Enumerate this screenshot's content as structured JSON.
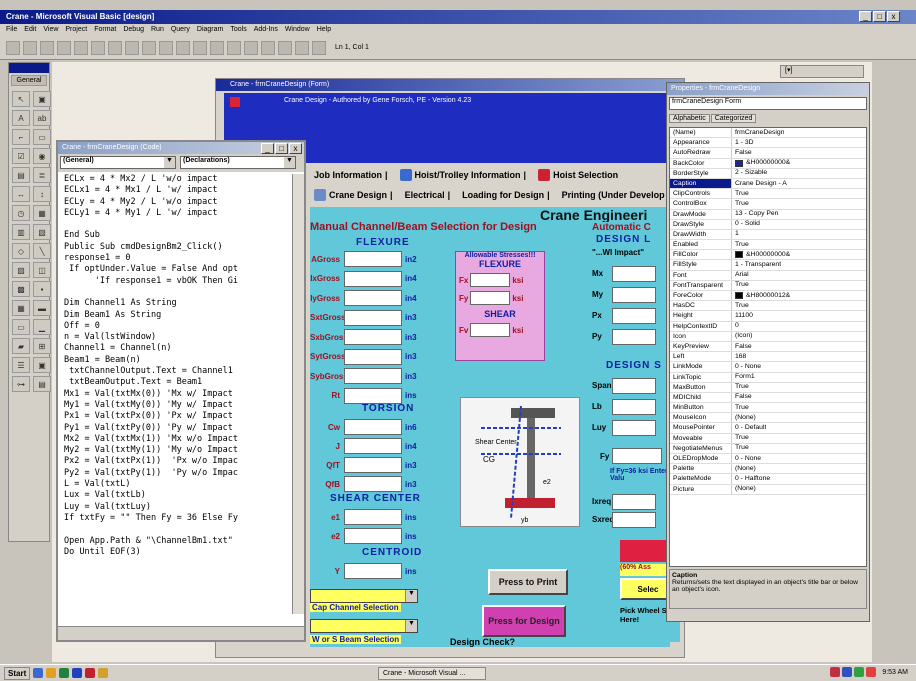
{
  "window": {
    "title": "Crane - Microsoft Visual Basic [design]"
  },
  "menu": [
    "File",
    "Edit",
    "View",
    "Project",
    "Format",
    "Debug",
    "Run",
    "Query",
    "Diagram",
    "Tools",
    "Add-Ins",
    "Window",
    "Help"
  ],
  "toolbar": {
    "position": "Ln 1, Col 1"
  },
  "toolbox": {
    "label": "General"
  },
  "form": {
    "title": "Crane - frmCraneDesign (Form)",
    "header": "Crane Design - Authored by Gene Forsch, PE - Version 4.23",
    "tabs_row1": [
      "Job Information",
      "Hoist/Trolley Information",
      "Hoist Selection"
    ],
    "tabs_row2": [
      "Crane Design",
      "Electrical",
      "Loading for Design",
      "Printing (Under Develop"
    ],
    "crane_engineering": "Crane Engineeri",
    "manual_title": "Manual Channel/Beam Selection for Design",
    "automatic_title": "Automatic C",
    "design_l": "DESIGN L",
    "flexure": {
      "heading": "FLEXURE",
      "fields": [
        {
          "label": "AGross",
          "unit": "in2"
        },
        {
          "label": "IxGross",
          "unit": "in4"
        },
        {
          "label": "IyGross",
          "unit": "in4"
        },
        {
          "label": "SxtGross",
          "unit": "in3"
        },
        {
          "label": "SxbGross",
          "unit": "in3"
        },
        {
          "label": "SytGross",
          "unit": "in3"
        },
        {
          "label": "SybGross",
          "unit": "in3"
        },
        {
          "label": "Rt",
          "unit": "ins"
        }
      ]
    },
    "torsion": {
      "heading": "TORSION",
      "fields": [
        {
          "label": "Cw",
          "unit": "in6"
        },
        {
          "label": "J",
          "unit": "in4"
        },
        {
          "label": "QfT",
          "unit": "in3"
        },
        {
          "label": "QfB",
          "unit": "in3"
        }
      ]
    },
    "shear_center": {
      "heading": "SHEAR CENTER",
      "fields": [
        {
          "label": "e1",
          "unit": "ins"
        },
        {
          "label": "e2",
          "unit": "ins"
        }
      ]
    },
    "centroid": {
      "heading": "CENTROID",
      "fields": [
        {
          "label": "Y",
          "unit": "ins"
        }
      ]
    },
    "allowable": {
      "title": "Allowable Stresses!!!",
      "flexure": "FLEXURE",
      "shear": "SHEAR",
      "rows": [
        {
          "label": "Fx",
          "unit": "ksi"
        },
        {
          "label": "Fy",
          "unit": "ksi"
        },
        {
          "label": "Fv",
          "unit": "ksi"
        }
      ]
    },
    "right_labels": [
      "Mx",
      "My",
      "Px",
      "Py"
    ],
    "wl_impact": "\"...Wl Impact\"",
    "design_s": "DESIGN S",
    "span_labels": [
      "Span",
      "Lb",
      "Luy"
    ],
    "fy_label": "Fy",
    "fy_note": "If Fy=36 ksi Enter Valu",
    "req_labels": [
      "Ixreq",
      "Sxreq"
    ],
    "percent_note": "(60% Ass",
    "select_label": "Selec",
    "pick_wheel": "Pick Wheel Size Here!",
    "diagram_labels": [
      "Shear Center",
      "CG",
      "e2",
      "yb"
    ],
    "btn_print": "Press to Print",
    "btn_design": "Press for Design",
    "cap_channel": "Cap Channel Selection",
    "w_beam": "W or S Beam Selection",
    "design_check": "Design Check?"
  },
  "code": {
    "title": "Crane - frmCraneDesign (Code)",
    "object": "(General)",
    "proc": "(Declarations)",
    "lines": [
      "ECLx = 4 * Mx2 / L 'w/o impact",
      "ECLx1 = 4 * Mx1 / L 'w/ impact",
      "ECLy = 4 * My2 / L 'w/o impact",
      "ECLy1 = 4 * My1 / L 'w/ impact",
      "",
      "End Sub",
      "Public Sub cmdDesignBm2_Click()",
      "response1 = 0",
      " If optUnder.Value = False And opt",
      "      'If response1 = vbOK Then Gi",
      "",
      "Dim Channel1 As String",
      "Dim Beam1 As String",
      "Off = 0",
      "n = Val(lstWindow)",
      "Channel1 = Channel(n)",
      "Beam1 = Beam(n)",
      " txtChannelOutput.Text = Channel1",
      " txtBeamOutput.Text = Beam1",
      "Mx1 = Val(txtMx(0)) 'Mx w/ Impact",
      "My1 = Val(txtMy(0)) 'My w/ Impact",
      "Px1 = Val(txtPx(0)) 'Px w/ Impact",
      "Py1 = Val(txtPy(0)) 'Py w/ Impact",
      "Mx2 = Val(txtMx(1)) 'Mx w/o Impact",
      "My2 = Val(txtMy(1)) 'My w/o Impact",
      "Px2 = Val(txtPx(1))  'Px w/o Impac",
      "Py2 = Val(txtPy(1))  'Py w/o Impac",
      "L = Val(txtL)",
      "Lux = Val(txtLb)",
      "Luy = Val(txtLuy)",
      "If txtFy = \"\" Then Fy = 36 Else Fy",
      "",
      "Open App.Path & \"\\ChannelBm1.txt\"",
      "Do Until EOF(3)"
    ]
  },
  "properties": {
    "title": "Properties - frmCraneDesign",
    "object": "frmCraneDesign  Form",
    "tab_alpha": "Alphabetic",
    "tab_cat": "Categorized",
    "rows": [
      {
        "n": "(Name)",
        "v": "frmCraneDesign"
      },
      {
        "n": "Appearance",
        "v": "1 - 3D"
      },
      {
        "n": "AutoRedraw",
        "v": "False"
      },
      {
        "n": "BackColor",
        "v": "&H00000000&",
        "c": "#1a2a9a"
      },
      {
        "n": "BorderStyle",
        "v": "2 - Sizable"
      },
      {
        "n": "Caption",
        "v": "Crane Design - A",
        "sel": true
      },
      {
        "n": "ClipControls",
        "v": "True"
      },
      {
        "n": "ControlBox",
        "v": "True"
      },
      {
        "n": "DrawMode",
        "v": "13 - Copy Pen"
      },
      {
        "n": "DrawStyle",
        "v": "0 - Solid"
      },
      {
        "n": "DrawWidth",
        "v": "1"
      },
      {
        "n": "Enabled",
        "v": "True"
      },
      {
        "n": "FillColor",
        "v": "&H00000000&",
        "c": "#000000"
      },
      {
        "n": "FillStyle",
        "v": "1 - Transparent"
      },
      {
        "n": "Font",
        "v": "Arial"
      },
      {
        "n": "FontTransparent",
        "v": "True"
      },
      {
        "n": "ForeColor",
        "v": "&H80000012&",
        "c": "#000000"
      },
      {
        "n": "HasDC",
        "v": "True"
      },
      {
        "n": "Height",
        "v": "11100"
      },
      {
        "n": "HelpContextID",
        "v": "0"
      },
      {
        "n": "Icon",
        "v": "(Icon)"
      },
      {
        "n": "KeyPreview",
        "v": "False"
      },
      {
        "n": "Left",
        "v": "168"
      },
      {
        "n": "LinkMode",
        "v": "0 - None"
      },
      {
        "n": "LinkTopic",
        "v": "Form1"
      },
      {
        "n": "MaxButton",
        "v": "True"
      },
      {
        "n": "MDIChild",
        "v": "False"
      },
      {
        "n": "MinButton",
        "v": "True"
      },
      {
        "n": "MouseIcon",
        "v": "(None)"
      },
      {
        "n": "MousePointer",
        "v": "0 - Default"
      },
      {
        "n": "Moveable",
        "v": "True"
      },
      {
        "n": "NegotiateMenus",
        "v": "True"
      },
      {
        "n": "OLEDropMode",
        "v": "0 - None"
      },
      {
        "n": "Palette",
        "v": "(None)"
      },
      {
        "n": "PaletteMode",
        "v": "0 - Halftone"
      },
      {
        "n": "Picture",
        "v": "(None)"
      }
    ],
    "desc_title": "Caption",
    "desc_text": "Returns/sets the text displayed in an object's title bar or below an object's icon."
  },
  "taskbar": {
    "start": "Start",
    "task": "Crane - Microsoft Visual ...",
    "clock": "9:53 AM"
  }
}
